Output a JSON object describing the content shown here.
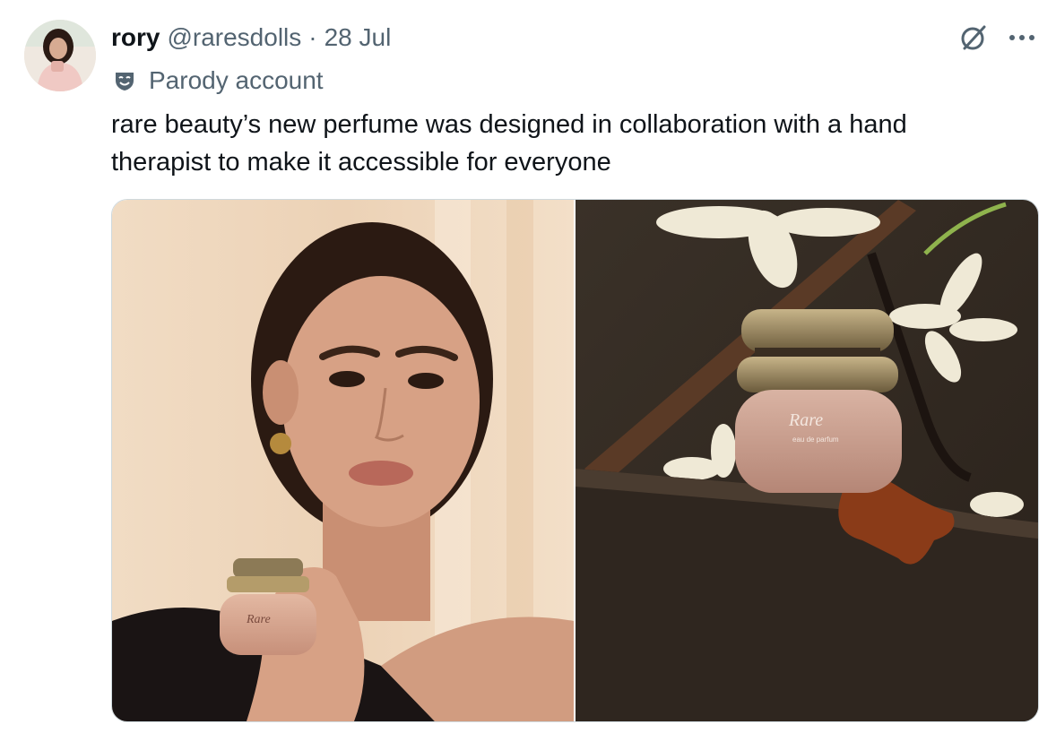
{
  "tweet": {
    "author_name": "rory",
    "author_handle": "@raresdolls",
    "separator": "·",
    "date": "28 Jul",
    "label_text": "Parody account",
    "text": "rare beauty’s new perfume was designed in collaboration with a hand therapist to make it accessible for everyone"
  },
  "icons": {
    "parody": "parody-mask-icon",
    "grok": "grok-icon",
    "more": "more-icon"
  },
  "media": {
    "left_bottle_label": "Rare",
    "right_bottle_label": "Rare",
    "right_bottle_sublabel": "eau de parfum"
  },
  "colors": {
    "text_primary": "#0f1419",
    "text_secondary": "#536471",
    "border": "#cfd9de"
  }
}
